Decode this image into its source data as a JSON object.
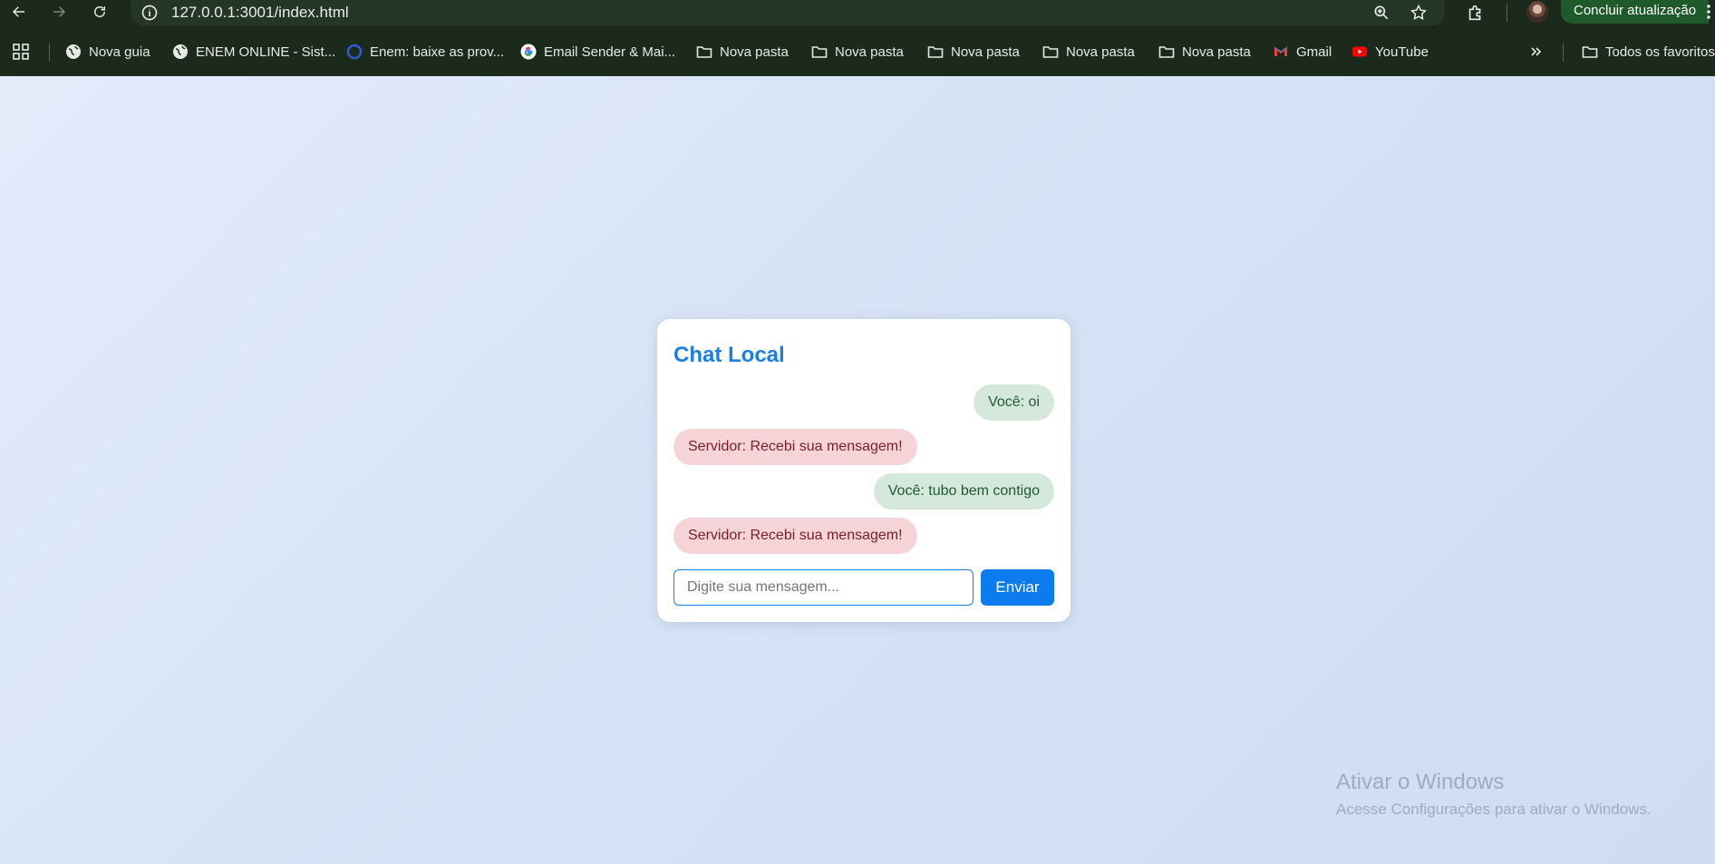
{
  "browser": {
    "url": "127.0.0.1:3001/index.html",
    "update_label": "Concluir atualização",
    "bookmarks": [
      {
        "label": "Nova guia",
        "icon": "globe-icon"
      },
      {
        "label": "ENEM ONLINE - Sist...",
        "icon": "globe-icon"
      },
      {
        "label": "Enem: baixe as prov...",
        "icon": "site-icon"
      },
      {
        "label": "Email Sender & Mai...",
        "icon": "google-icon"
      },
      {
        "label": "Nova pasta",
        "icon": "folder-icon"
      },
      {
        "label": "Nova pasta",
        "icon": "folder-icon"
      },
      {
        "label": "Nova pasta",
        "icon": "folder-icon"
      },
      {
        "label": "Nova pasta",
        "icon": "folder-icon"
      },
      {
        "label": "Nova pasta",
        "icon": "folder-icon"
      },
      {
        "label": "Gmail",
        "icon": "gmail-icon"
      },
      {
        "label": "YouTube",
        "icon": "youtube-icon"
      }
    ],
    "all_bookmarks_label": "Todos os favoritos"
  },
  "chat": {
    "title": "Chat Local",
    "messages": [
      {
        "sender": "me",
        "text": "Você: oi"
      },
      {
        "sender": "server",
        "text": "Servidor: Recebi sua mensagem!"
      },
      {
        "sender": "me",
        "text": "Você: tubo bem contigo"
      },
      {
        "sender": "server",
        "text": "Servidor: Recebi sua mensagem!"
      }
    ],
    "input_value": "",
    "input_placeholder": "Digite sua mensagem...",
    "send_label": "Enviar"
  },
  "watermark": {
    "line1": "Ativar o Windows",
    "line2": "Acesse Configurações para ativar o Windows."
  },
  "colors": {
    "accent": "#1a7fe0",
    "send_button": "#0d7bf0",
    "my_bubble": "#d4e8dc",
    "server_bubble": "#f5d3d6",
    "chrome_bg": "#1c2a1c"
  }
}
